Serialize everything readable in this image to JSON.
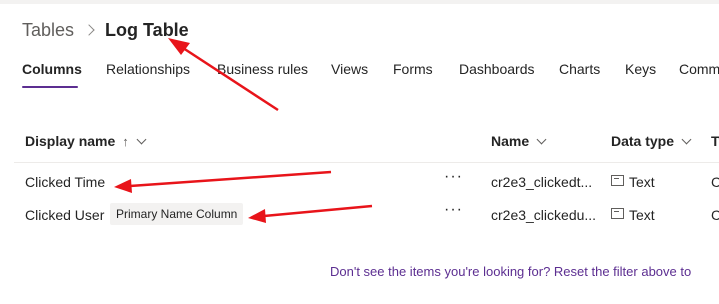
{
  "breadcrumb": {
    "root": "Tables",
    "current": "Log Table"
  },
  "tabs": [
    {
      "label": "Columns",
      "active": true
    },
    {
      "label": "Relationships"
    },
    {
      "label": "Business rules"
    },
    {
      "label": "Views"
    },
    {
      "label": "Forms"
    },
    {
      "label": "Dashboards"
    },
    {
      "label": "Charts"
    },
    {
      "label": "Keys"
    },
    {
      "label": "Comm"
    }
  ],
  "grid": {
    "headers": {
      "display_name": "Display name",
      "sort_arrow": "↑",
      "name": "Name",
      "data_type": "Data type",
      "type": "Ty"
    },
    "rows": [
      {
        "display_name": "Clicked Time",
        "badge": "",
        "more": "···",
        "name": "cr2e3_clickedt...",
        "data_type": "Text",
        "type": "C"
      },
      {
        "display_name": "Clicked User",
        "badge": "Primary Name Column",
        "more": "···",
        "name": "cr2e3_clickedu...",
        "data_type": "Text",
        "type": "C"
      }
    ]
  },
  "footer": {
    "message": "Don't see the items you're looking for? Reset the filter above to"
  },
  "colors": {
    "accent": "#5c2e91",
    "annotation_arrow": "#e8141a"
  }
}
